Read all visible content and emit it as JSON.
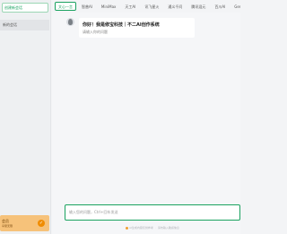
{
  "sidebar": {
    "new_chat_label": "创建新会话",
    "conversation_label": "新的会话",
    "promo_title": "会员",
    "promo_subtitle": "享受无限",
    "promo_button_icon": "✓"
  },
  "tabs": [
    {
      "label": "文心一言",
      "active": true
    },
    {
      "label": "智普AI"
    },
    {
      "label": "MiniMax"
    },
    {
      "label": "天工AI"
    },
    {
      "label": "讯飞星火"
    },
    {
      "label": "通义千问"
    },
    {
      "label": "腾讯混元"
    },
    {
      "label": "百川AI"
    },
    {
      "label": "Gem"
    }
  ],
  "chat": {
    "greeting": "你好！我是修宝科技｜不二AI创作系统",
    "sub": "请输入你的问题"
  },
  "input": {
    "placeholder": "输入您的问题，Ctrl+回车发送"
  },
  "footer": {
    "left": "AI生成内容仅供参考",
    "right": "请勿输入敏感信息"
  },
  "colors": {
    "accent": "#1aa260",
    "promo": "#f6c27a"
  }
}
